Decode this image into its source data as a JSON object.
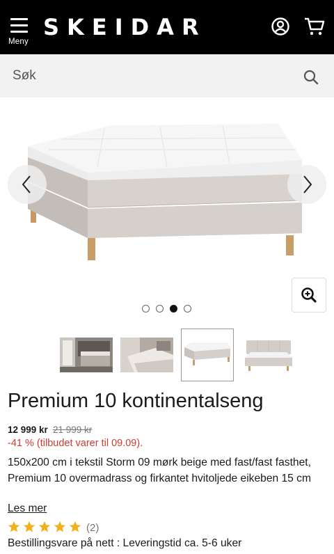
{
  "header": {
    "menu_label": "Meny",
    "logo_text": "SKEIDAR",
    "background": "#000000"
  },
  "search": {
    "placeholder": "Søk"
  },
  "gallery": {
    "dots_count": 4,
    "active_dot": 2,
    "thumbnails": [
      "room-bed-thumbnail",
      "bedroom-scene-thumbnail",
      "continental-bed-thumbnail",
      "bed-with-headboard-thumbnail"
    ],
    "active_thumbnail": 2
  },
  "product": {
    "title": "Premium 10 kontinentalseng",
    "price": "12 999 kr",
    "old_price": "21 999 kr",
    "discount": "-41 % (tilbudet varer til 09.09).",
    "description": "150x200 cm i tekstil Storm 09 mørk beige med fast/fast fasthet, Premium 10 overmadrass og firkantet hvitoljede eikeben 15 cm",
    "read_more": "Les mer",
    "rating": 5,
    "review_count": "(2)",
    "delivery": "Bestillingsvare på nett : Leveringstid ca. 5-6 uker"
  },
  "colors": {
    "discount": "#d23a2e",
    "star": "#f2b01e"
  }
}
